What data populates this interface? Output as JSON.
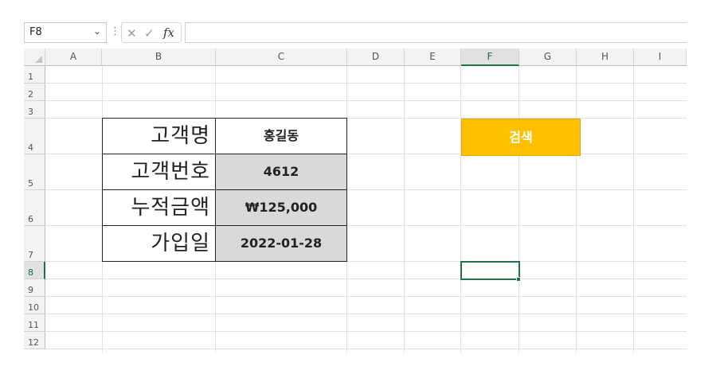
{
  "formula_bar": {
    "name_box": "F8",
    "formula": ""
  },
  "columns": [
    "A",
    "B",
    "C",
    "D",
    "E",
    "F",
    "G",
    "H",
    "I"
  ],
  "rows": [
    "1",
    "2",
    "3",
    "4",
    "5",
    "6",
    "7",
    "8",
    "9",
    "10",
    "11",
    "12"
  ],
  "customer_table": {
    "rows": [
      {
        "label": "고객명",
        "value": "홍길동"
      },
      {
        "label": "고객번호",
        "value": "4612"
      },
      {
        "label": "누적금액",
        "value": "₩125,000"
      },
      {
        "label": "가입일",
        "value": "2022-01-28"
      }
    ]
  },
  "search_button": {
    "label": "검색",
    "color": "#ffc000"
  },
  "selected_cell": "F8",
  "colors": {
    "selection": "#217346"
  }
}
